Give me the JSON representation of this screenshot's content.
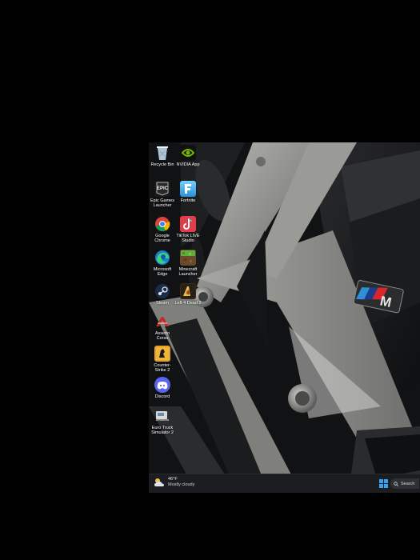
{
  "desktop": {
    "icons": [
      {
        "label": "Recycle Bin",
        "icon": "recycle-bin-icon"
      },
      {
        "label": "NVIDIA App",
        "icon": "nvidia-icon"
      },
      {
        "label": "Epic Games Launcher",
        "icon": "epic-games-icon"
      },
      {
        "label": "Fortnite",
        "icon": "fortnite-icon"
      },
      {
        "label": "Google Chrome",
        "icon": "chrome-icon"
      },
      {
        "label": "TikTok LIVE Studio",
        "icon": "tiktok-live-icon"
      },
      {
        "label": "Microsoft Edge",
        "icon": "edge-icon"
      },
      {
        "label": "Minecraft Launcher",
        "icon": "minecraft-icon"
      },
      {
        "label": "Steam",
        "icon": "steam-icon"
      },
      {
        "label": "Left 4 Dead 2",
        "icon": "left4dead-icon"
      },
      {
        "label": "Assetto Corsa",
        "icon": "assetto-corsa-icon"
      },
      {
        "label": "Counter-Strike 2",
        "icon": "counter-strike-icon"
      },
      {
        "label": "Discord",
        "icon": "discord-icon"
      },
      {
        "label": "Euro Truck Simulator 2",
        "icon": "euro-truck-icon"
      }
    ]
  },
  "wallpaper": {
    "badge_text": "M"
  },
  "taskbar": {
    "weather": {
      "temp": "46°F",
      "condition": "Mostly cloudy"
    },
    "search_label": "Search"
  },
  "colors": {
    "taskbar_bg": "#1c1d20",
    "bmw_blue_light": "#2f8fd6",
    "bmw_blue_dark": "#1e3b8a",
    "bmw_red": "#d8262b"
  }
}
